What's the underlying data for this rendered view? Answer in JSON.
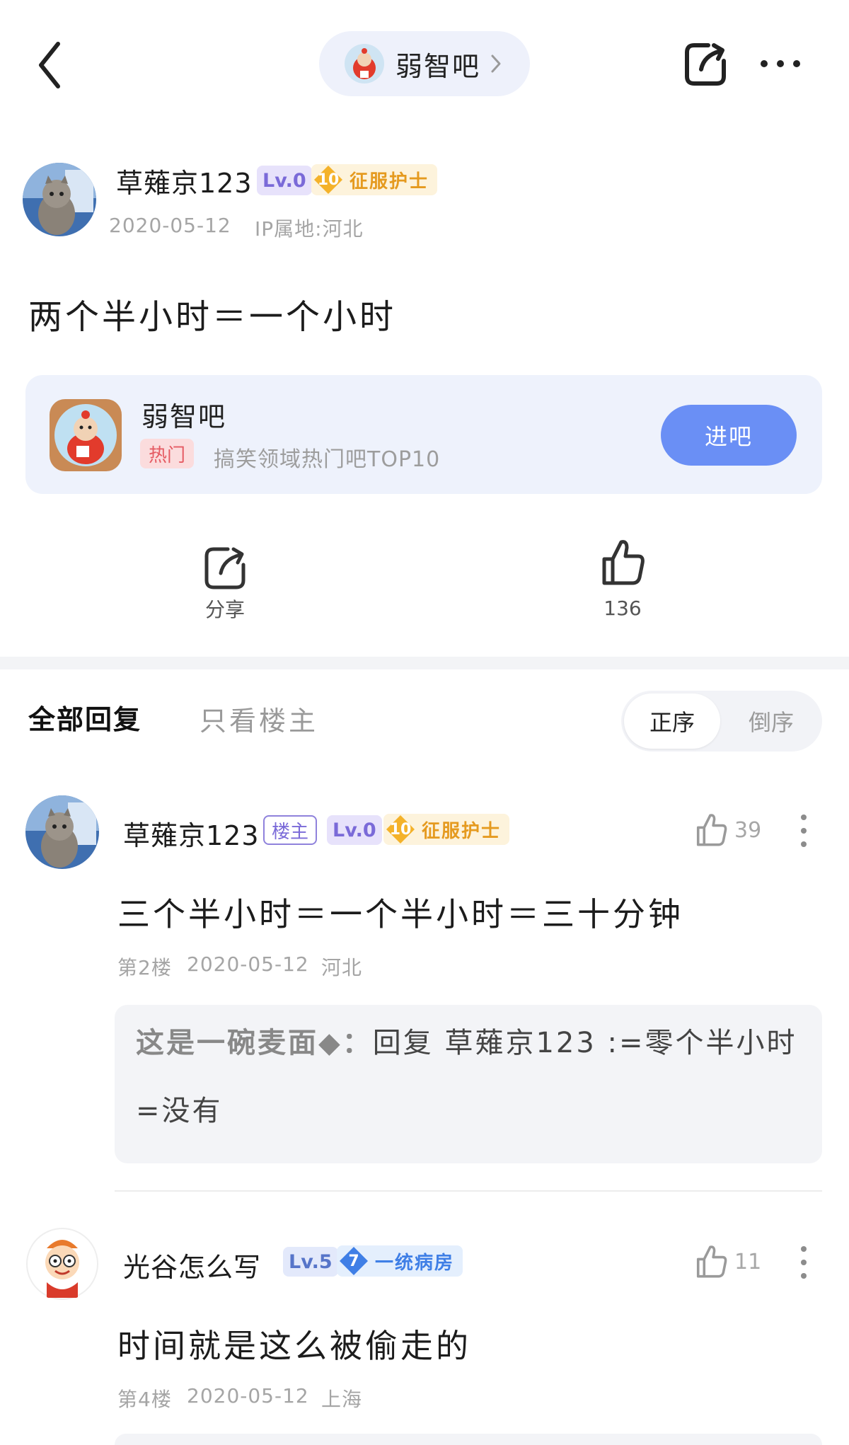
{
  "header": {
    "forum_name": "弱智吧"
  },
  "post": {
    "author": {
      "username": "草薙京123",
      "level": "Lv.0",
      "badge_number": "10",
      "badge_title": "征服护士"
    },
    "date": "2020-05-12",
    "ip_location": "IP属地:河北",
    "content": "两个半小时＝一个小时"
  },
  "forum_card": {
    "name": "弱智吧",
    "hot_tag": "热门",
    "description": "搞笑领域热门吧TOP10",
    "join_label": "进吧"
  },
  "actions": {
    "share_label": "分享",
    "like_count": "136"
  },
  "replies_header": {
    "tab_all": "全部回复",
    "tab_op_only": "只看楼主",
    "sort_asc": "正序",
    "sort_desc": "倒序"
  },
  "comments": [
    {
      "username": "草薙京123",
      "op_tag": "楼主",
      "level": "Lv.0",
      "badge_number": "10",
      "badge_title": "征服护士",
      "like_count": "39",
      "content": "三个半小时＝一个半小时＝三十分钟",
      "floor": "第2楼",
      "date": "2020-05-12",
      "location": "河北",
      "sub_reply": {
        "author": "这是一碗麦面◆：",
        "text": "回复 草薙京123 :=零个半小时=没有"
      }
    },
    {
      "username": "光谷怎么写",
      "level": "Lv.5",
      "badge_number": "7",
      "badge_title": "一统病房",
      "like_count": "11",
      "content": "时间就是这么被偷走的",
      "floor": "第4楼",
      "date": "2020-05-12",
      "location": "上海"
    }
  ],
  "colors": {
    "accent_blue": "#6a8ff5",
    "level_purple": "#7a6ad8",
    "badge_gold": "#e59a1f",
    "badge_blue": "#3f7fe6",
    "hot_red": "#e55b63"
  },
  "icons": [
    "back-arrow-icon",
    "chevron-right-icon",
    "share-icon",
    "more-icon",
    "thumbs-up-icon"
  ]
}
